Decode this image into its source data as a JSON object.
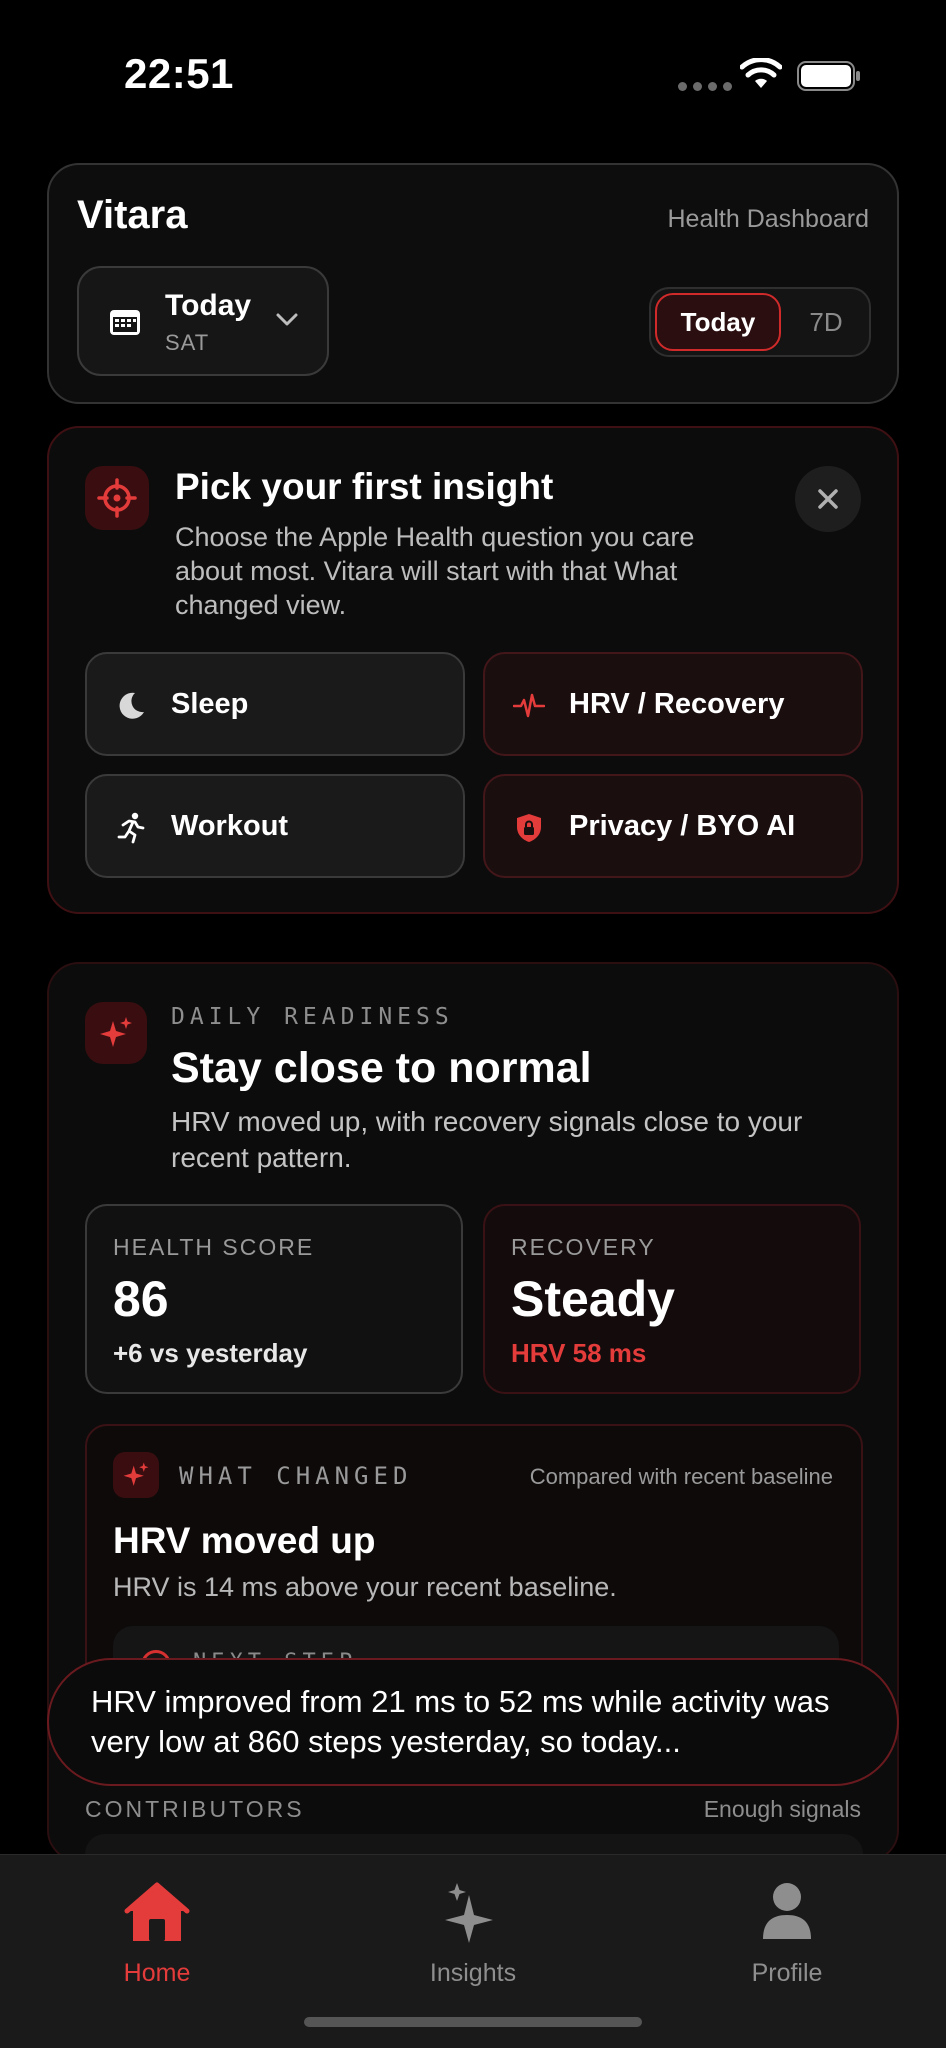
{
  "status_bar": {
    "time": "22:51"
  },
  "header": {
    "app_title": "Vitara",
    "subtitle": "Health Dashboard",
    "date_label": "Today",
    "date_weekday": "SAT",
    "segments": [
      "Today",
      "7D"
    ],
    "selected_segment": "Today"
  },
  "insight_prompt": {
    "title": "Pick your first insight",
    "description": "Choose the Apple Health question you care about most. Vitara will start with that What changed view.",
    "options": [
      {
        "label": "Sleep",
        "icon": "moon-icon"
      },
      {
        "label": "HRV / Recovery",
        "icon": "heartbeat-icon"
      },
      {
        "label": "Workout",
        "icon": "running-icon"
      },
      {
        "label": "Privacy / BYO AI",
        "icon": "shield-lock-icon"
      }
    ]
  },
  "readiness": {
    "eyebrow": "DAILY READINESS",
    "title": "Stay close to normal",
    "description": "HRV moved up, with recovery signals close to your recent pattern.",
    "health_score": {
      "label": "HEALTH SCORE",
      "value": "86",
      "sub": "+6 vs yesterday"
    },
    "recovery": {
      "label": "RECOVERY",
      "value": "Steady",
      "sub": "HRV 58 ms"
    },
    "what_changed": {
      "eyebrow": "WHAT CHANGED",
      "baseline_note": "Compared with recent baseline",
      "title": "HRV moved up",
      "description": "HRV is 14 ms above your recent baseline.",
      "next_step_label": "NEXT STEP"
    },
    "contributors_label": "CONTRIBUTORS",
    "contributors_status": "Enough signals"
  },
  "toast": {
    "text": "HRV improved from 21 ms to 52 ms while activity was very low at 860 steps yesterday, so today..."
  },
  "tab_bar": {
    "tabs": [
      {
        "label": "Home",
        "icon": "home-icon",
        "active": true
      },
      {
        "label": "Insights",
        "icon": "sparkles-icon",
        "active": false
      },
      {
        "label": "Profile",
        "icon": "person-icon",
        "active": false
      }
    ]
  },
  "colors": {
    "accent": "#e43b3b",
    "background": "#000000",
    "card": "#0c0c0c",
    "muted_text": "#9a9a9a"
  }
}
